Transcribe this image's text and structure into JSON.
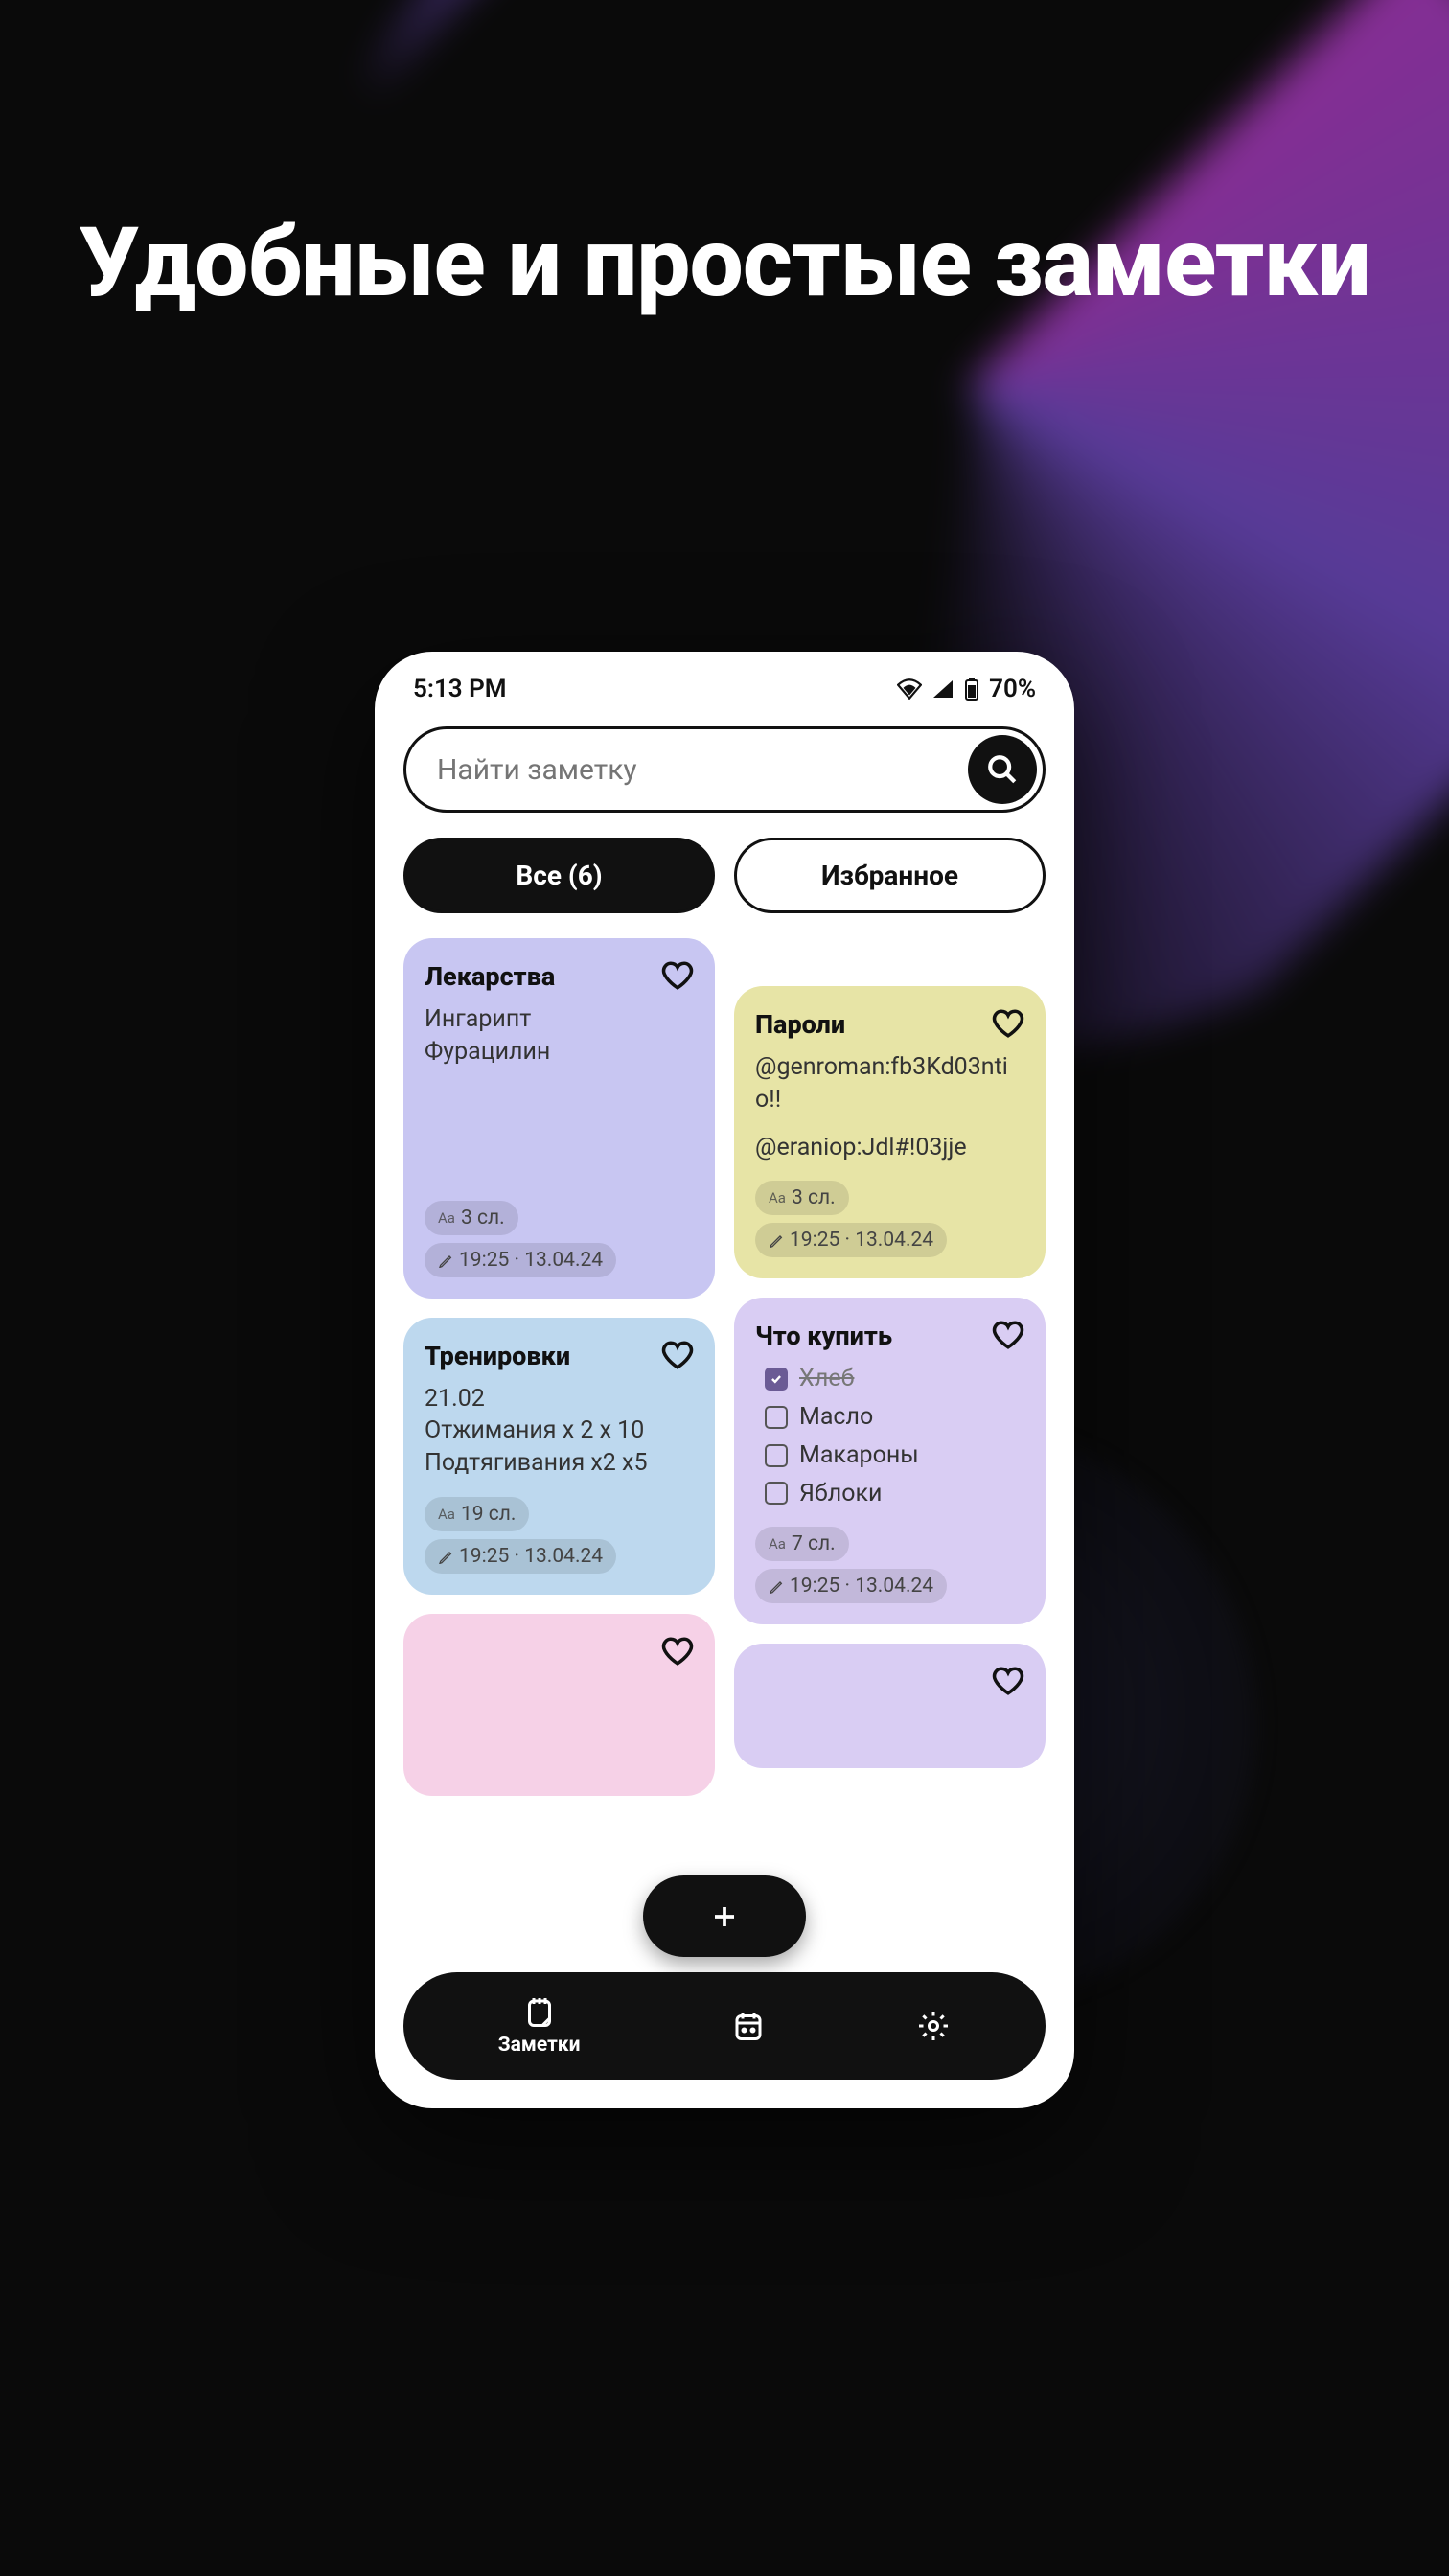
{
  "headline": "Удобные и простые заметки",
  "status": {
    "time": "5:13 PM",
    "battery": "70%"
  },
  "search": {
    "placeholder": "Найти заметку"
  },
  "filters": {
    "all": "Все (6)",
    "fav": "Избранное"
  },
  "notes": {
    "meds": {
      "title": "Лекарства",
      "body_l1": "Ингарипт",
      "body_l2": "Фурацилин",
      "words": "3 сл.",
      "ts": "19:25 · 13.04.24"
    },
    "train": {
      "title": "Тренировки",
      "body_l1": "21.02",
      "body_l2": "Отжимания x 2 x 10",
      "body_l3": "Подтягивания x2 x5",
      "words": "19 сл.",
      "ts": "19:25 · 13.04.24"
    },
    "pass": {
      "title": "Пароли",
      "body_l1": "@genroman:fb3Kd03ntio!!",
      "body_l2": "@eraniop:Jdl#!03jje",
      "words": "3 сл.",
      "ts": "19:25 · 13.04.24"
    },
    "shop": {
      "title": "Что купить",
      "items": [
        {
          "label": "Хлеб",
          "done": true
        },
        {
          "label": "Масло",
          "done": false
        },
        {
          "label": "Макароны",
          "done": false
        },
        {
          "label": "Яблоки",
          "done": false
        }
      ],
      "words": "7 сл.",
      "ts": "19:25 · 13.04.24"
    }
  },
  "nav": {
    "notes": "Заметки"
  }
}
